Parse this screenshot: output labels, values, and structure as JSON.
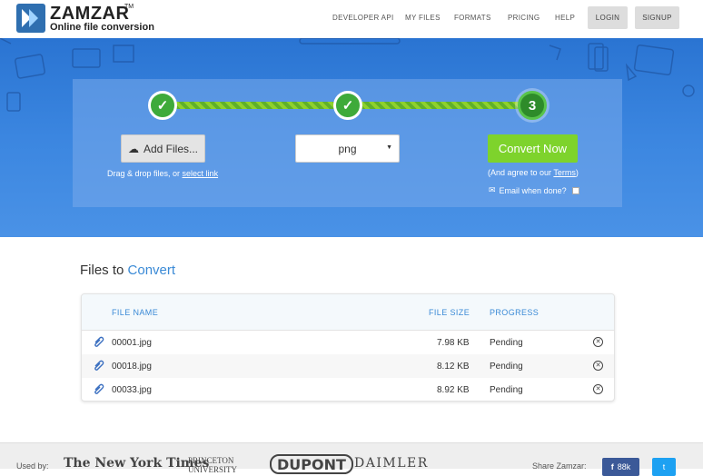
{
  "header": {
    "logo_text": "ZAMZAR",
    "logo_tm": "TM",
    "tagline": "Online file conversion",
    "nav": [
      "DEVELOPER API",
      "MY FILES",
      "FORMATS",
      "PRICING",
      "HELP"
    ],
    "login_label": "LOGIN",
    "signup_label": "SIGNUP"
  },
  "converter": {
    "steps": [
      "✓",
      "✓",
      "3"
    ],
    "add_files_label": "Add Files...",
    "drag_text": "Drag & drop files, or ",
    "select_link": "select link",
    "format_value": "png",
    "convert_label": "Convert Now",
    "agree_prefix": "(And agree to our ",
    "terms_label": "Terms",
    "agree_suffix": ")",
    "email_label": "Email when done?"
  },
  "files": {
    "title_prefix": "Files to ",
    "title_accent": "Convert",
    "columns": {
      "name": "FILE NAME",
      "size": "FILE SIZE",
      "progress": "PROGRESS"
    },
    "rows": [
      {
        "name": "00001.jpg",
        "size": "7.98 KB",
        "progress": "Pending"
      },
      {
        "name": "00018.jpg",
        "size": "8.12 KB",
        "progress": "Pending"
      },
      {
        "name": "00033.jpg",
        "size": "8.92 KB",
        "progress": "Pending"
      }
    ]
  },
  "footer": {
    "used_by": "Used by:",
    "brands": [
      "The New York Times",
      "PRINCETON UNIVERSITY",
      "DUPONT",
      "DAIMLER"
    ],
    "share_label": "Share Zamzar:",
    "facebook_count": "88k",
    "twitter_label": "t"
  },
  "colors": {
    "hero": "#3b86e0",
    "accent": "#3a8ad6",
    "convert": "#7ed32c",
    "step": "#3eaa3a"
  }
}
